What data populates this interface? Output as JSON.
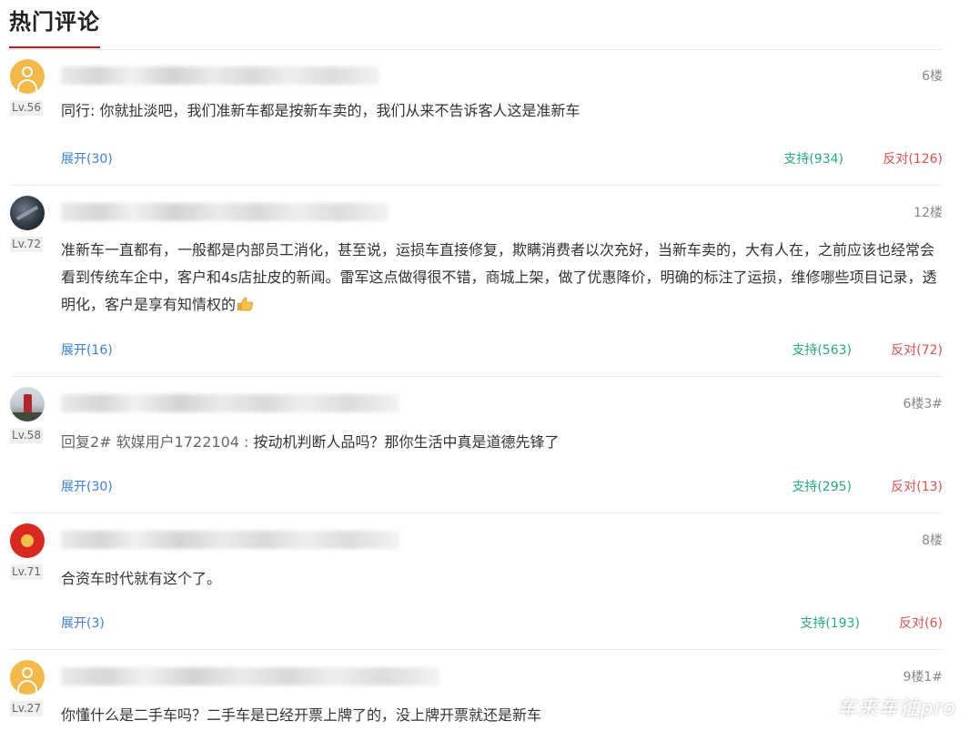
{
  "header": {
    "title": "热门评论"
  },
  "comments": [
    {
      "level": "Lv.56",
      "floor": "6楼",
      "content_prefix": "",
      "content": "同行: 你就扯淡吧，我们准新车都是按新车卖的，我们从来不告诉客人这是准新车",
      "expand": "展开(30)",
      "support": "支持(934)",
      "oppose": "反对(126)",
      "avatar": "default-avatar-icon"
    },
    {
      "level": "Lv.72",
      "floor": "12楼",
      "content_prefix": "",
      "content": "准新车一直都有，一般都是内部员工消化，甚至说，运损车直接修复，欺瞒消费者以次充好，当新车卖的，大有人在，之前应该也经常会看到传统车企中，客户和4s店扯皮的新闻。雷军这点做得很不错，商城上架，做了优惠降价，明确的标注了运损，维修哪些项目记录，透明化，客户是享有知情权的",
      "expand": "展开(16)",
      "support": "支持(563)",
      "oppose": "反对(72)",
      "avatar": "dark-photo-avatar",
      "emoji": "thumbs-up-icon"
    },
    {
      "level": "Lv.58",
      "floor": "6楼3#",
      "content_prefix": "回复2# 软媒用户1722104 : ",
      "content": "按动机判断人品吗？那你生活中真是道德先锋了",
      "expand": "展开(30)",
      "support": "支持(295)",
      "oppose": "反对(13)",
      "avatar": "lighthouse-photo-avatar"
    },
    {
      "level": "Lv.71",
      "floor": "8楼",
      "content_prefix": "",
      "content": "合资车时代就有这个了。",
      "expand": "展开(3)",
      "support": "支持(193)",
      "oppose": "反对(6)",
      "avatar": "red-emblem-avatar"
    },
    {
      "level": "Lv.27",
      "floor": "9楼1#",
      "content_prefix": "",
      "content": "你懂什么是二手车吗？二手车是已经开票上牌了的，没上牌开票就还是新车",
      "avatar": "default-avatar-icon"
    }
  ],
  "watermark": "车来车往pro",
  "colors": {
    "accent_red": "#c8161d",
    "link_blue": "#3a7fd5",
    "support_green": "#29a884",
    "oppose_red": "#e05050"
  }
}
